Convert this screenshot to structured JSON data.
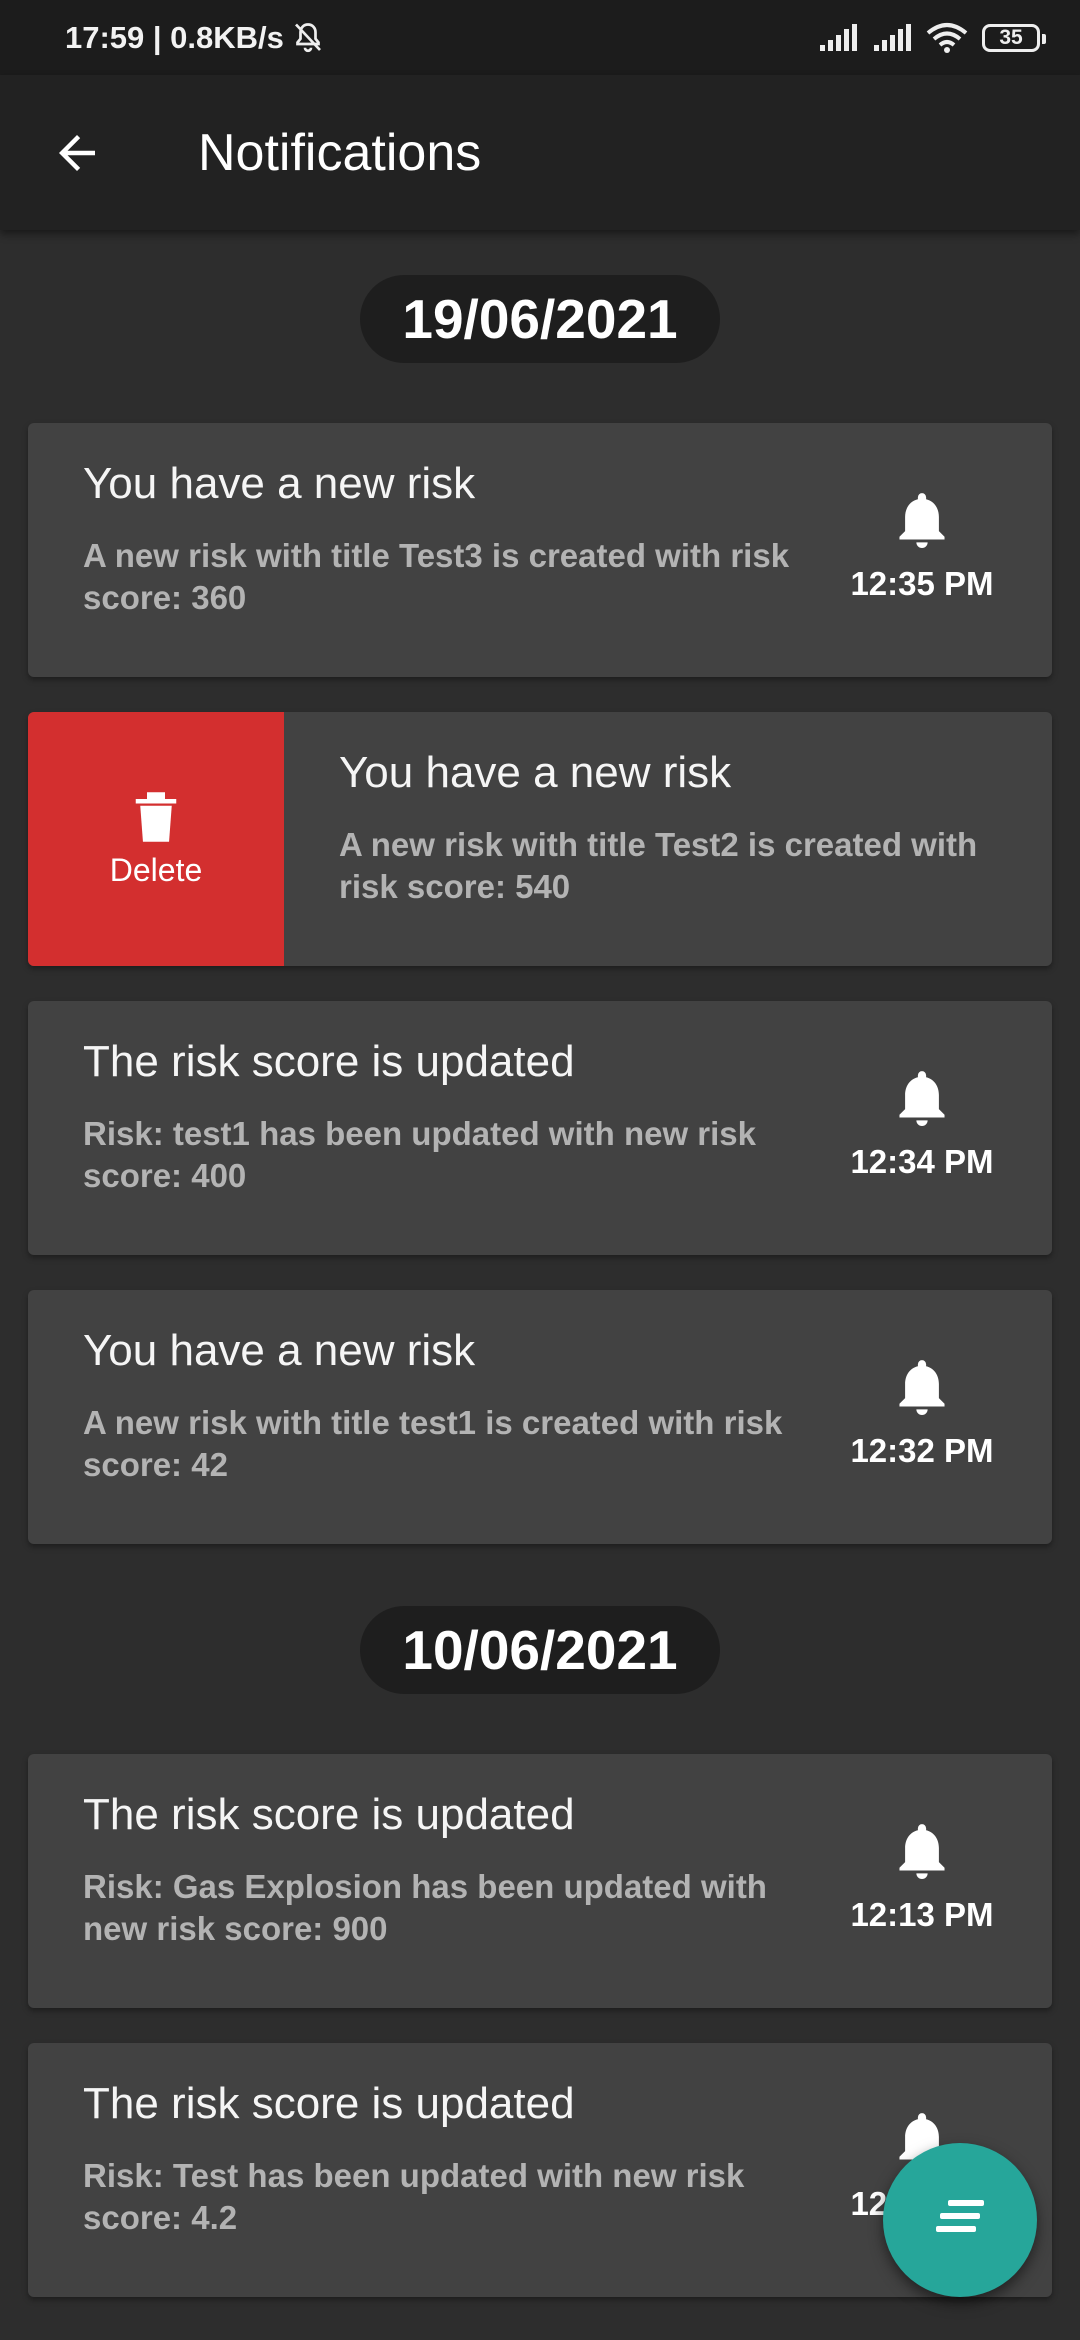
{
  "status_bar": {
    "time_speed": "17:59 | 0.8KB/s",
    "battery": "35"
  },
  "app_bar": {
    "title": "Notifications"
  },
  "groups": [
    {
      "date": "19/06/2021",
      "items": [
        {
          "title": "You have a new risk",
          "body": "A new risk with title Test3 is created with risk score: 360",
          "time": "12:35 PM"
        },
        {
          "title": "You have a new risk",
          "body": "A new risk with title Test2 is created with risk score: 540",
          "time": "",
          "swiped": true,
          "action_label": "Delete"
        },
        {
          "title": "The risk score is updated",
          "body": "Risk: test1 has been updated with new risk score: 400",
          "time": "12:34 PM"
        },
        {
          "title": "You have a new risk",
          "body": "A new risk with title test1 is created with risk score: 42",
          "time": "12:32 PM"
        }
      ]
    },
    {
      "date": "10/06/2021",
      "items": [
        {
          "title": "The risk score is updated",
          "body": "Risk: Gas Explosion has been updated with new risk score: 900",
          "time": "12:13 PM"
        },
        {
          "title": "The risk score is updated",
          "body": "Risk: Test has been updated with new risk score: 4.2",
          "time": "12:13 PM"
        }
      ]
    }
  ],
  "icons": {
    "back": "arrow-left-icon",
    "bell": "bell-icon",
    "delete": "trash-icon",
    "fab": "sort-icon"
  },
  "colors": {
    "delete": "#d32f2f",
    "fab": "#26a69a"
  }
}
